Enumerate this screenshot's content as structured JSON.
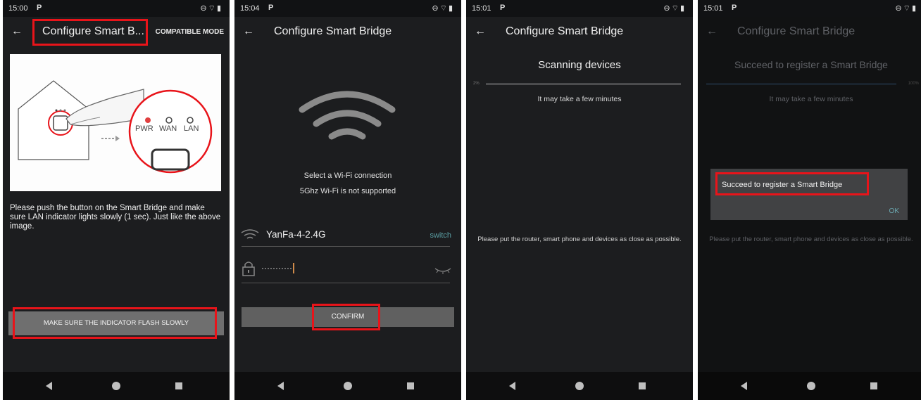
{
  "p1": {
    "status_time": "15:00",
    "status_icon_text": "P",
    "title": "Configure Smart B...",
    "compat": "COMPATIBLE MODE",
    "led_labels": [
      "PWR",
      "WAN",
      "LAN"
    ],
    "instruction": "Please push the button on the Smart Bridge and make sure LAN indicator lights slowly (1 sec). Just like the above image.",
    "button": "MAKE SURE THE INDICATOR FLASH SLOWLY"
  },
  "p2": {
    "status_time": "15:04",
    "status_icon_text": "P",
    "title": "Configure Smart Bridge",
    "select_line1": "Select a Wi-Fi connection",
    "select_line2": "5Ghz Wi-Fi is not supported",
    "ssid": "YanFa-4-2.4G",
    "switch": "switch",
    "password_mask": "···········",
    "confirm": "CONFIRM"
  },
  "p3": {
    "status_time": "15:01",
    "status_icon_text": "P",
    "title": "Configure Smart Bridge",
    "scanning": "Scanning devices",
    "progress_label": "2%",
    "progress_percent": 2,
    "sub": "It may take a few minutes",
    "note": "Please put the router, smart phone and devices as close as possible."
  },
  "p4": {
    "status_time": "15:01",
    "status_icon_text": "P",
    "title": "Configure Smart Bridge",
    "heading": "Succeed to register a Smart Bridge",
    "progress_label": "100%",
    "progress_percent": 100,
    "sub": "It may take a few minutes",
    "note": "Please put the router, smart phone and devices as close as possible.",
    "dialog_msg": "Succeed to register a Smart Bridge",
    "ok": "OK"
  },
  "colors": {
    "highlight": "#e8141a",
    "screen_bg": "#1c1d1f",
    "link_teal": "#5a9ea3",
    "pwr_led": "#e04040"
  },
  "status_icons": [
    "do-not-disturb-icon",
    "wifi-icon",
    "battery-icon"
  ]
}
